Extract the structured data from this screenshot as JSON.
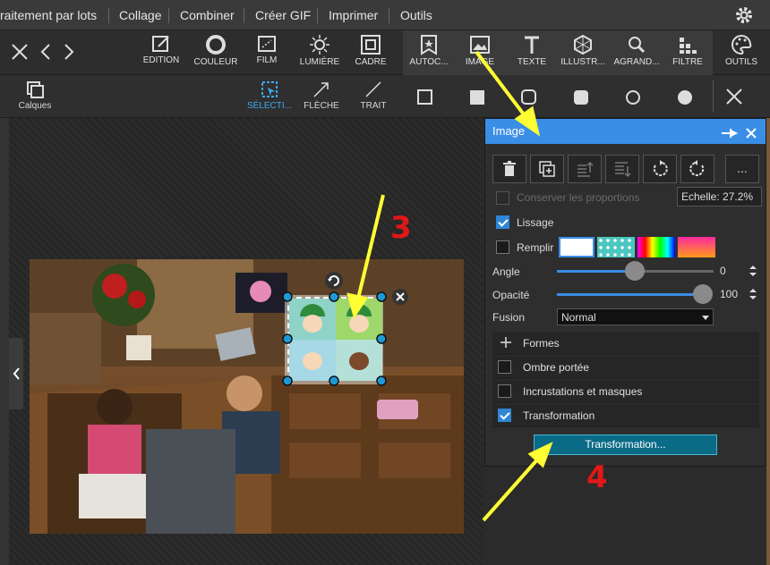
{
  "menu": {
    "items": [
      "raitement par lots",
      "Collage",
      "Combiner",
      "Créer GIF",
      "Imprimer",
      "Outils"
    ]
  },
  "toolbar": {
    "edition": "EDITION",
    "couleur": "COULEUR",
    "film": "FILM",
    "lumiere": "LUMIÈRE",
    "cadre": "CADRE",
    "autoc": "AUTOC...",
    "image": "IMAGE",
    "texte": "TEXTE",
    "illustr": "ILLUSTR...",
    "agrand": "AGRAND...",
    "filtre": "FILTRE",
    "outils": "OUTILS"
  },
  "subbar": {
    "calques": "Calques",
    "selection": "SÉLECTI...",
    "fleche": "FLÈCHE",
    "trait": "TRAIT"
  },
  "panel": {
    "title": "Image",
    "keep_proportions": "Conserver les proportions",
    "scale": "Echelle: 27.2%",
    "smoothing": "Lissage",
    "fill": "Remplir",
    "angle_label": "Angle",
    "angle_value": "0",
    "opacity_label": "Opacité",
    "opacity_value": "100",
    "blend_label": "Fusion",
    "blend_value": "Normal",
    "more_btn": "...",
    "sections": {
      "formes": "Formes",
      "ombre": "Ombre portée",
      "incrustations": "Incrustations et masques",
      "transformation": "Transformation"
    },
    "transform_button": "Transformation..."
  },
  "annotations": {
    "num3": "3",
    "num4": "4"
  },
  "colors": {
    "accent": "#3a8ee6",
    "annotation_arrow": "#ffff33",
    "annotation_number": "#e01818"
  }
}
